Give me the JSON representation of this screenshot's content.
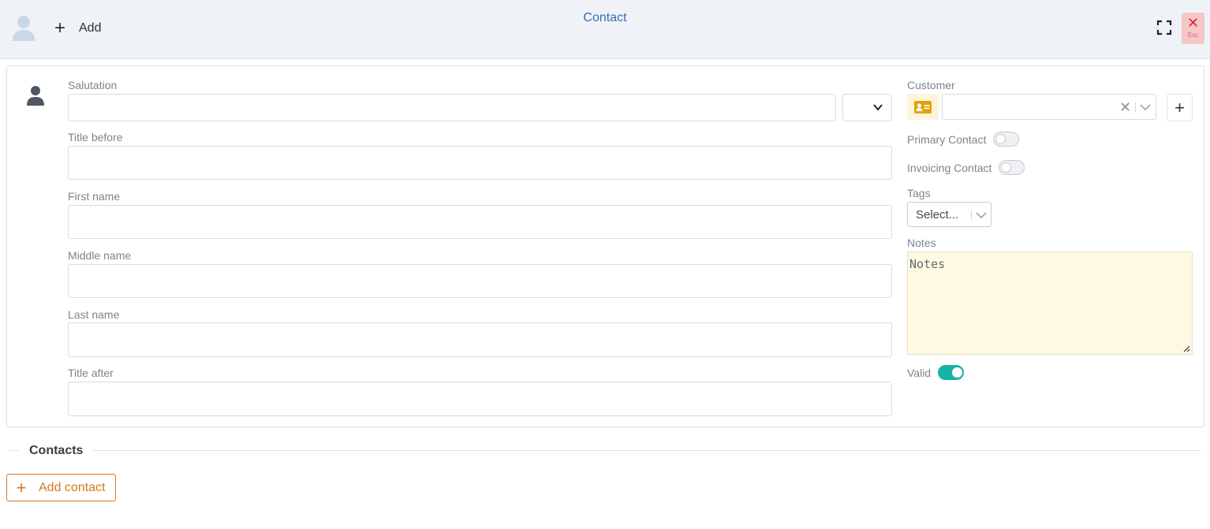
{
  "header": {
    "add_label": "Add",
    "title": "Contact",
    "close_label": "✕",
    "close_hint": "Esc"
  },
  "form": {
    "salutation": {
      "label": "Salutation",
      "value": "",
      "select_value": ""
    },
    "title_before": {
      "label": "Title before",
      "value": ""
    },
    "first_name": {
      "label": "First name",
      "value": ""
    },
    "middle_name": {
      "label": "Middle name",
      "value": ""
    },
    "last_name": {
      "label": "Last name",
      "value": ""
    },
    "title_after": {
      "label": "Title after",
      "value": ""
    }
  },
  "side": {
    "customer": {
      "label": "Customer",
      "value": "",
      "clear": "✕"
    },
    "primary_contact": {
      "label": "Primary Contact",
      "on": false
    },
    "invoicing_contact": {
      "label": "Invoicing Contact",
      "on": false
    },
    "tags": {
      "label": "Tags",
      "placeholder": "Select..."
    },
    "notes": {
      "label": "Notes",
      "placeholder": "Notes",
      "value": ""
    },
    "valid": {
      "label": "Valid",
      "on": true
    }
  },
  "contacts": {
    "title": "Contacts",
    "add_label": "Add contact"
  },
  "colors": {
    "accent": "#2f6fb0",
    "toggle_on": "#17b3a3",
    "add_contact": "#d9771c",
    "close_bg": "#f6c6c9",
    "close_fg": "#e0262f",
    "notes_bg": "#fdf9e3"
  }
}
